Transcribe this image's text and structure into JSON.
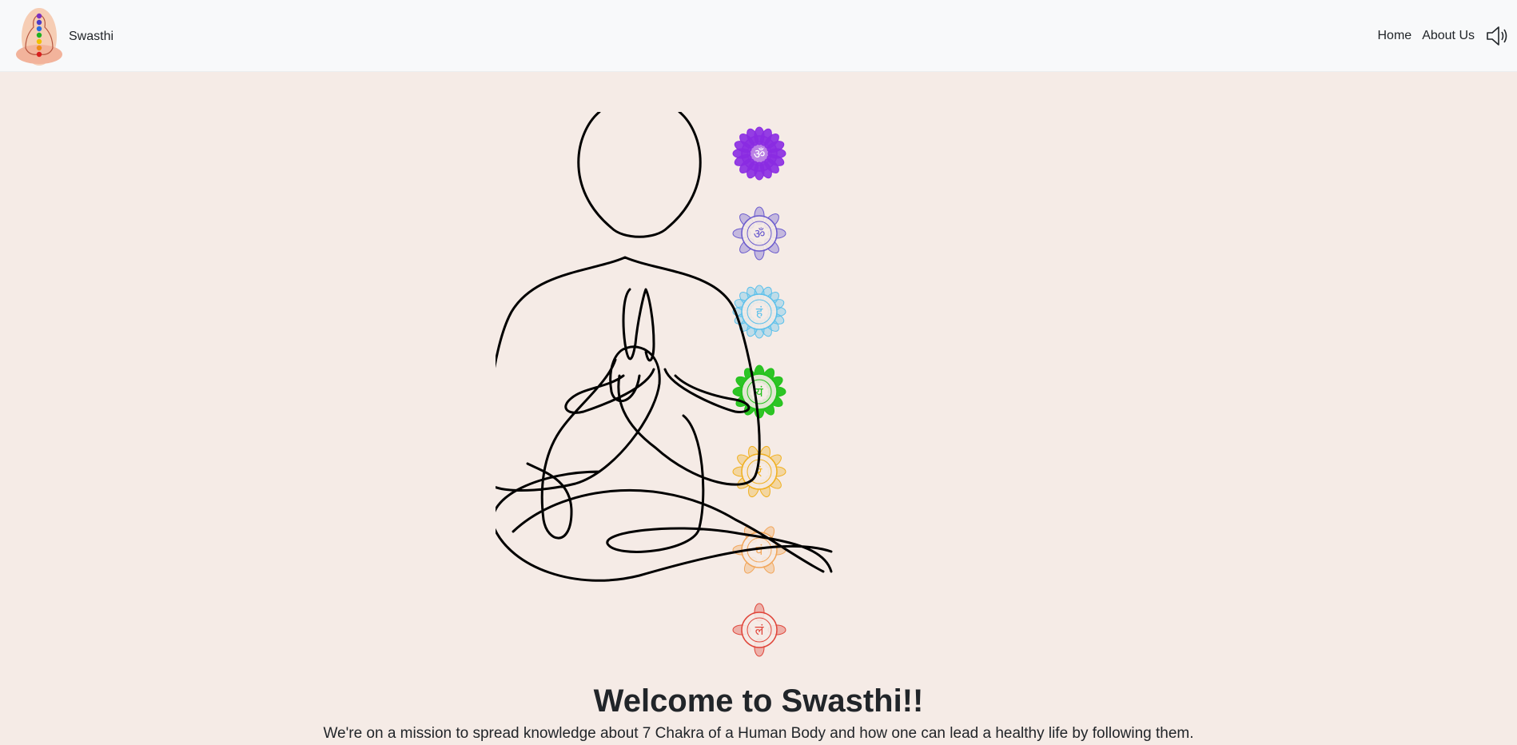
{
  "navbar": {
    "brand_name": "Swasthi",
    "links": [
      "Home",
      "About Us"
    ],
    "sound_icon": "speaker-volume-icon"
  },
  "hero": {
    "figure_icon": "meditating-figure-icon",
    "chakras": [
      {
        "name": "crown-chakra-icon",
        "color": "#8a2be2",
        "glyph": "ॐ"
      },
      {
        "name": "third-eye-chakra-icon",
        "color": "#6a5acd",
        "glyph": "ॐ"
      },
      {
        "name": "throat-chakra-icon",
        "color": "#5bc0eb",
        "glyph": "हं"
      },
      {
        "name": "heart-chakra-icon",
        "color": "#22c21a",
        "glyph": "यं"
      },
      {
        "name": "solar-plexus-chakra-icon",
        "color": "#f0b020",
        "glyph": "रं"
      },
      {
        "name": "sacral-chakra-icon",
        "color": "#f2a65a",
        "glyph": "वं"
      },
      {
        "name": "root-chakra-icon",
        "color": "#e0453a",
        "glyph": "लं"
      }
    ]
  },
  "content": {
    "title": "Welcome to Swasthi!!",
    "subtitle": "We're on a mission to spread knowledge about 7 Chakra of a Human Body and how one can lead a healthy life by following them."
  }
}
